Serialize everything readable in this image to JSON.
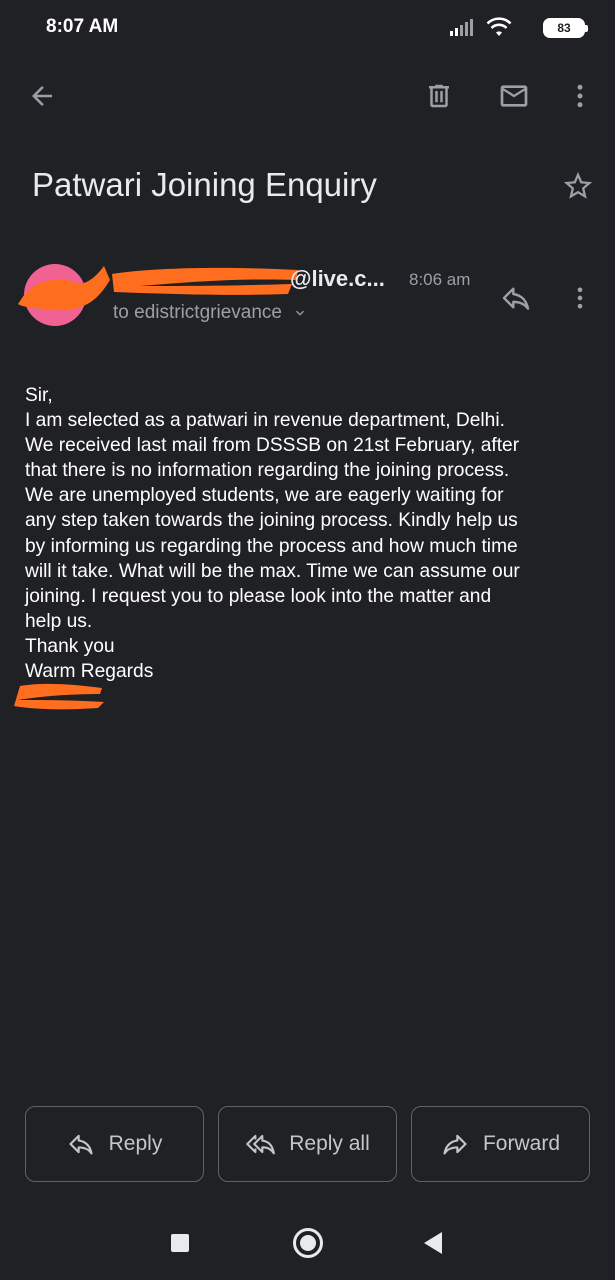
{
  "status_bar": {
    "time": "8:07 AM",
    "battery": "83"
  },
  "toolbar": {
    "icons": [
      "back-arrow-icon",
      "trash-icon",
      "mail-icon",
      "more-vert-icon"
    ]
  },
  "email": {
    "subject": "Patwari Joining Enquiry",
    "sender_visible": "@live.c...",
    "time": "8:06 am",
    "recipient": "to edistrictgrievance",
    "body_lines": [
      "Sir,",
      "I am selected as a patwari in revenue department, Delhi.",
      "We received last mail from DSSSB on 21st February, after",
      "that there is no information regarding the joining process.",
      "We are unemployed students, we are eagerly waiting for",
      "any step taken towards the joining process. Kindly help us",
      "by informing us regarding the process and how much time",
      "will it take. What will be the max. Time we can assume our",
      "joining. I request you to please look into the matter and",
      "help us.",
      "Thank you",
      "Warm Regards"
    ]
  },
  "actions": {
    "reply": "Reply",
    "reply_all": "Reply all",
    "forward": "Forward"
  },
  "colors": {
    "background": "#202124",
    "avatar": "#f06292",
    "redaction": "#ff6d1f"
  }
}
